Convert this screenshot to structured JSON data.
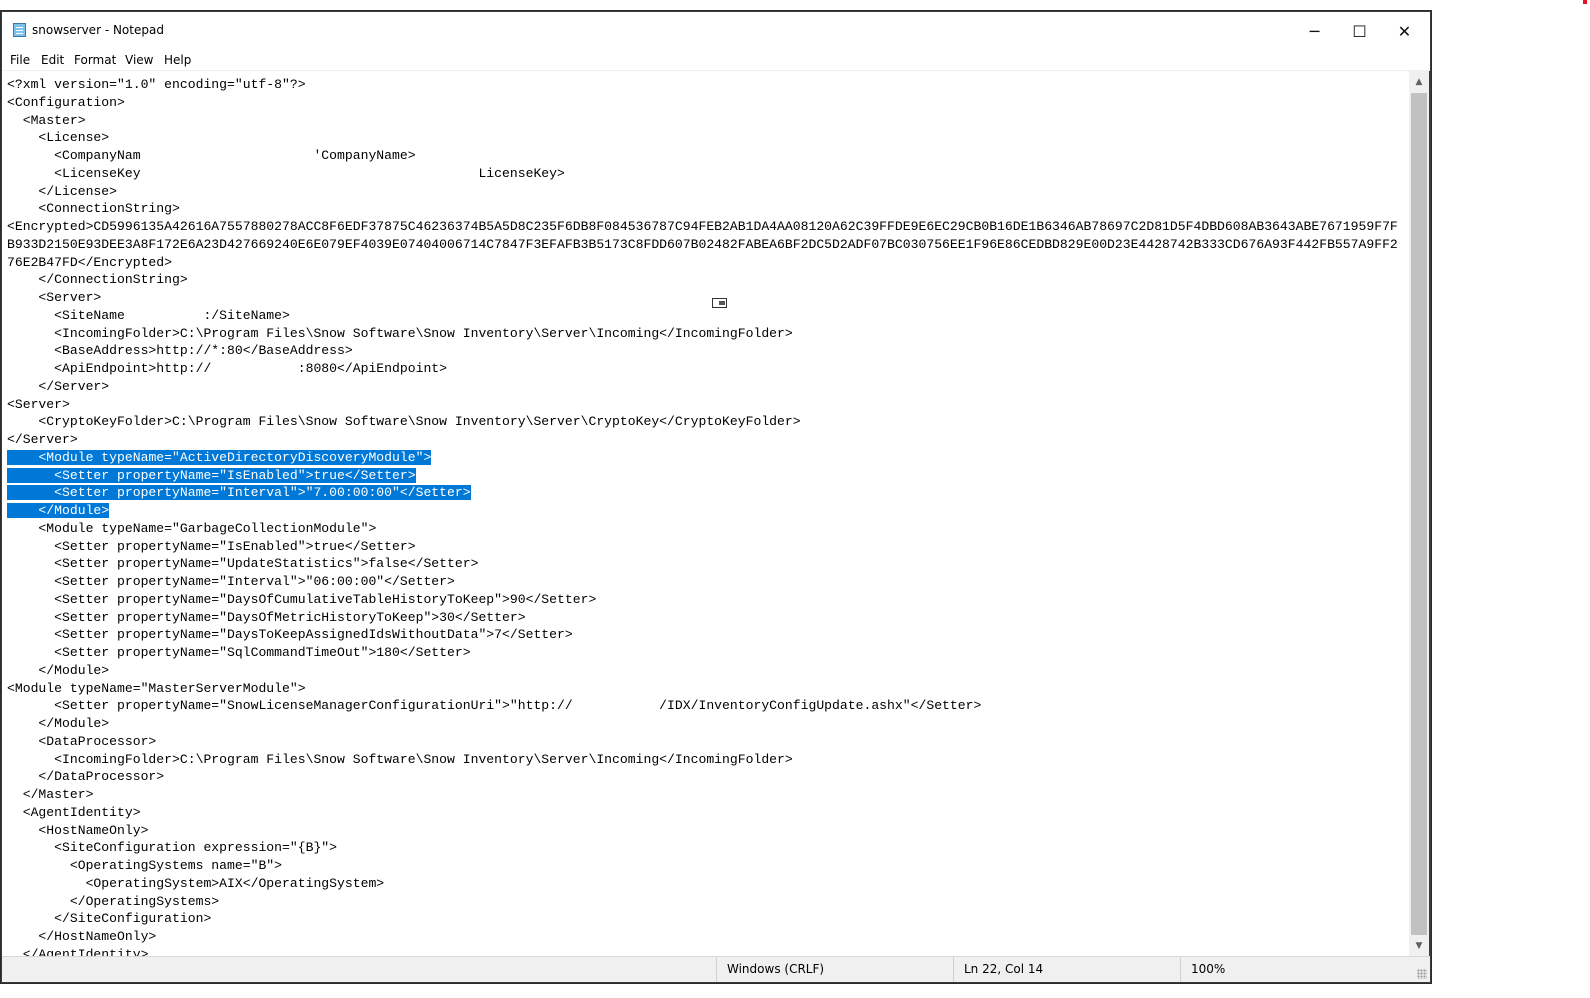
{
  "window": {
    "title": "snowserver - Notepad",
    "minimize_glyph": "─",
    "maximize_glyph": "☐",
    "close_glyph": "✕"
  },
  "menu": [
    "File",
    "Edit",
    "Format",
    "View",
    "Help"
  ],
  "editor_lines": [
    {
      "text": "<?xml version=\"1.0\" encoding=\"utf-8\"?>"
    },
    {
      "text": "<Configuration>"
    },
    {
      "text": "  <Master>"
    },
    {
      "text": "    <License>"
    },
    {
      "text": "      <CompanyNam                      'CompanyName>"
    },
    {
      "text": "      <LicenseKey                                           LicenseKey>"
    },
    {
      "text": "    </License>"
    },
    {
      "text": "    <ConnectionString>"
    },
    {
      "text": "<Encrypted>CD5996135A42616A7557880278ACC8F6EDF37875C46236374B5A5D8C235F6DB8F084536787C94FEB2AB1DA4AA08120A62C39FFDE9E6EC29CB0B16DE1B6346AB78697C2D81D5F4DBD608AB3643ABE7671959F7F"
    },
    {
      "text": "B933D2150E93DEE3A8F172E6A23D427669240E6E079EF4039E07404006714C7847F3EFAFB3B5173C8FDD607B02482FABEA6BF2DC5D2ADF07BC030756EE1F96E86CEDBD829E00D23E4428742B333CD676A93F442FB557A9FF2"
    },
    {
      "text": "76E2B47FD</Encrypted>"
    },
    {
      "text": "    </ConnectionString>"
    },
    {
      "text": "    <Server>"
    },
    {
      "text": "      <SiteName          :/SiteName>"
    },
    {
      "text": "      <IncomingFolder>C:\\Program Files\\Snow Software\\Snow Inventory\\Server\\Incoming</IncomingFolder>"
    },
    {
      "text": "      <BaseAddress>http://*:80</BaseAddress>"
    },
    {
      "text": "      <ApiEndpoint>http://           :8080</ApiEndpoint>"
    },
    {
      "text": "    </Server>"
    },
    {
      "text": "<Server>"
    },
    {
      "text": "    <CryptoKeyFolder>C:\\Program Files\\Snow Software\\Snow Inventory\\Server\\CryptoKey</CryptoKeyFolder>"
    },
    {
      "text": "</Server>"
    },
    {
      "pre": "    ",
      "sel": "<Module typeName=\"ActiveDirectoryDiscoveryModule\">"
    },
    {
      "sel": "      <Setter propertyName=\"IsEnabled\">true</Setter>"
    },
    {
      "sel": "      <Setter propertyName=\"Interval\">\"7.00:00:00\"</Setter>"
    },
    {
      "sel": "    </Module>"
    },
    {
      "text": "    <Module typeName=\"GarbageCollectionModule\">"
    },
    {
      "text": "      <Setter propertyName=\"IsEnabled\">true</Setter>"
    },
    {
      "text": "      <Setter propertyName=\"UpdateStatistics\">false</Setter>"
    },
    {
      "text": "      <Setter propertyName=\"Interval\">\"06:00:00\"</Setter>"
    },
    {
      "text": "      <Setter propertyName=\"DaysOfCumulativeTableHistoryToKeep\">90</Setter>"
    },
    {
      "text": "      <Setter propertyName=\"DaysOfMetricHistoryToKeep\">30</Setter>"
    },
    {
      "text": "      <Setter propertyName=\"DaysToKeepAssignedIdsWithoutData\">7</Setter>"
    },
    {
      "text": "      <Setter propertyName=\"SqlCommandTimeOut\">180</Setter>"
    },
    {
      "text": "    </Module>"
    },
    {
      "text": "<Module typeName=\"MasterServerModule\">"
    },
    {
      "text": "      <Setter propertyName=\"SnowLicenseManagerConfigurationUri\">\"http://           /IDX/InventoryConfigUpdate.ashx\"</Setter>"
    },
    {
      "text": "    </Module>"
    },
    {
      "text": "    <DataProcessor>"
    },
    {
      "text": "      <IncomingFolder>C:\\Program Files\\Snow Software\\Snow Inventory\\Server\\Incoming</IncomingFolder>"
    },
    {
      "text": "    </DataProcessor>"
    },
    {
      "text": "  </Master>"
    },
    {
      "text": "  <AgentIdentity>"
    },
    {
      "text": "    <HostNameOnly>"
    },
    {
      "text": "      <SiteConfiguration expression=\"{B}\">"
    },
    {
      "text": "        <OperatingSystems name=\"B\">"
    },
    {
      "text": "          <OperatingSystem>AIX</OperatingSystem>"
    },
    {
      "text": "        </OperatingSystems>"
    },
    {
      "text": "      </SiteConfiguration>"
    },
    {
      "text": "    </HostNameOnly>"
    },
    {
      "text": "  </AgentIdentity>"
    }
  ],
  "scrollbar": {
    "up_glyph": "▲",
    "down_glyph": "▼"
  },
  "status": {
    "encoding": "Windows (CRLF)",
    "position": "Ln 22, Col 14",
    "zoom": "100%"
  },
  "colors": {
    "selection": "#0078d7",
    "window_frame": "#3c3c3c"
  }
}
